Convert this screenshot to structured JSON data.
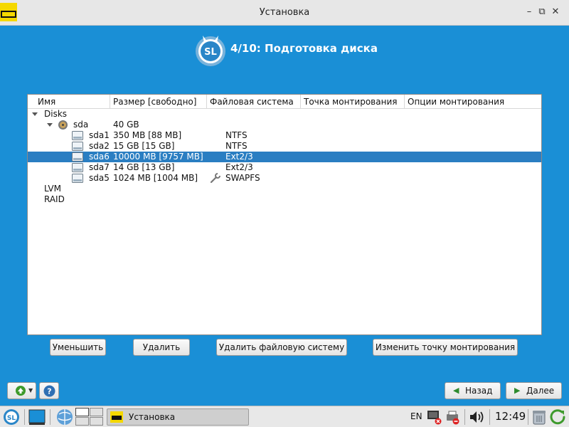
{
  "window": {
    "title": "Установка"
  },
  "header": {
    "step_title": "4/10: Подготовка диска",
    "logo_text": "SL"
  },
  "table": {
    "columns": [
      "Имя",
      "Размер [свободно]",
      "Файловая система",
      "Точка монтирования",
      "Опции монтирования"
    ],
    "rows": [
      {
        "name": "Disks",
        "size": "",
        "fs": ""
      },
      {
        "name": "sda",
        "size": "40 GB",
        "fs": ""
      },
      {
        "name": "sda1",
        "size": "350 MB [88 MB]",
        "fs": "NTFS"
      },
      {
        "name": "sda2",
        "size": "15 GB [15 GB]",
        "fs": "NTFS"
      },
      {
        "name": "sda6",
        "size": "10000 MB [9757 MB]",
        "fs": "Ext2/3"
      },
      {
        "name": "sda7",
        "size": "14 GB [13 GB]",
        "fs": "Ext2/3"
      },
      {
        "name": "sda5",
        "size": "1024 MB [1004 MB]",
        "fs": "SWAPFS"
      },
      {
        "name": "LVM",
        "size": "",
        "fs": ""
      },
      {
        "name": "RAID",
        "size": "",
        "fs": ""
      }
    ]
  },
  "actions": {
    "shrink": "Уменьшить",
    "delete": "Удалить",
    "delete_fs": "Удалить файловую систему",
    "change_mount": "Изменить точку монтирования"
  },
  "nav": {
    "back": "Назад",
    "next": "Далее",
    "back_icon": "◀",
    "next_icon": "▶",
    "help_icon": "?"
  },
  "taskbar": {
    "start_text": "SL",
    "task_title": "Установка",
    "lang": "EN",
    "clock": "12:49"
  },
  "colors": {
    "accent": "#1a8fd6",
    "selection": "#2a7ec2"
  }
}
